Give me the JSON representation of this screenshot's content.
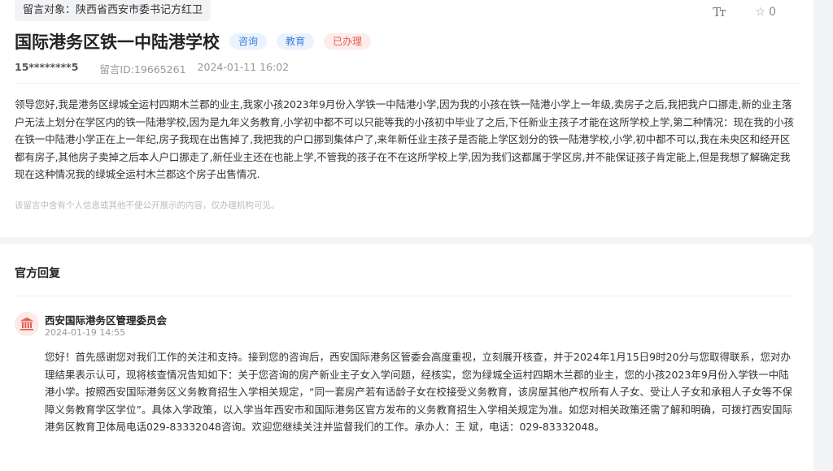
{
  "target": {
    "label": "留言对象：",
    "value": "陕西省西安市委书记方红卫"
  },
  "tools": {
    "font_glyph": "Tт",
    "star_count": "0"
  },
  "post": {
    "title": "国际港务区铁一中陆港学校",
    "tags": [
      "咨询",
      "教育",
      "已办理"
    ],
    "phone": "15********5",
    "message_id": "留言ID:19665261",
    "time": "2024-01-11 16:02",
    "content": "领导您好,我是港务区绿城全运村四期木兰郡的业主,我家小孩2023年9月份入学铁一中陆港小学,因为我的小孩在铁一陆港小学上一年级,卖房子之后,我把我户口挪走,新的业主落户无法上划分在学区内的铁一陆港学校,因为是九年义务教育,小学初中都不可以只能等我的小孩初中毕业了之后,下任新业主孩子才能在这所学校上学,第二种情况：现在我的小孩在铁一中陆港小学正在上一年纪,房子我现在出售掉了,我把我的户口挪到集体户了,来年新任业主孩子是否能上学区划分的铁一陆港学校,小学,初中都不可以,我在未央区和经开区都有房子,其他房子卖掉之后本人户口挪走了,新任业主还在也能上学,不管我的孩子在不在这所学校上学,因为我们这都属于学区房,并不能保证孩子肯定能上,但是我想了解确定我现在这种情况我的绿城全运村木兰郡这个房子出售情况.",
    "privacy_notice": "该留言中含有个人信息或其他不便公开展示的内容，仅办理机构可见。"
  },
  "reply": {
    "heading": "官方回复",
    "org": "西安国际港务区管理委员会",
    "date": "2024-01-19 14:55",
    "content": "您好！首先感谢您对我们工作的关注和支持。接到您的咨询后，西安国际港务区管委会高度重视，立刻展开核查，并于2024年1月15日9时20分与您取得联系，您对办理结果表示认可，现将核查情况告知如下：关于您咨询的房产新业主子女入学问题，经核实，您为绿城全运村四期木兰郡的业主，您的小孩2023年9月份入学铁一中陆港小学。按照西安国际港务区义务教育招生入学相关规定，“同一套房产若有适龄子女在校接受义务教育，该房屋其他产权所有人子女、受让人子女和承租人子女等不保障义务教育学区学位”。具体入学政策，以入学当年西安市和国际港务区官方发布的义务教育招生入学相关规定为准。如您对相关政策还需了解和明确，可拨打西安国际港务区教育卫体局电话029-83332048咨询。欢迎您继续关注并监督我们的工作。承办人：王 斌，电话：029-83332048。"
  },
  "colors": {
    "tag_blue": "#3d7fd9",
    "tag_red": "#e25a4f",
    "avatar_bg": "#fde9e8"
  }
}
